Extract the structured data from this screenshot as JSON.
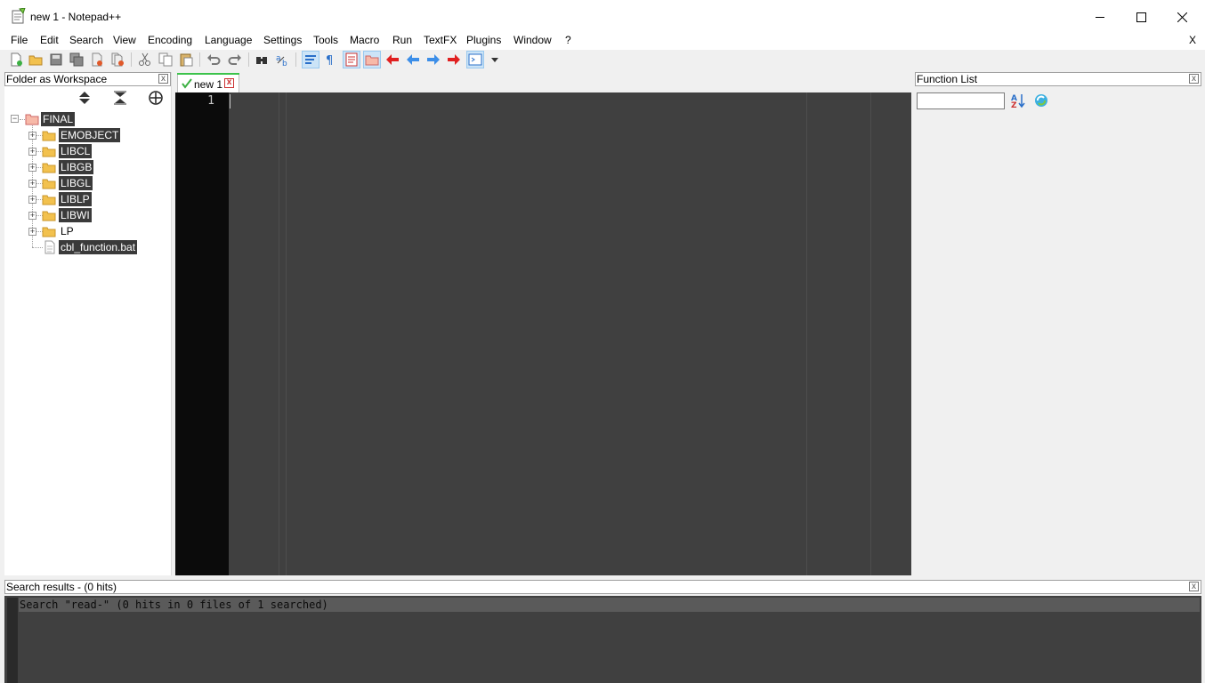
{
  "window": {
    "title": "new 1 - Notepad++",
    "app_icon": "notepad-icon",
    "controls": [
      "minimize-icon",
      "maximize-icon",
      "close-icon"
    ]
  },
  "menu": {
    "items": [
      "File",
      "Edit",
      "Search",
      "View",
      "Encoding",
      "Language",
      "Settings",
      "Tools",
      "Macro",
      "Run",
      "TextFX",
      "Plugins",
      "Window",
      "?"
    ],
    "close_x": "X"
  },
  "toolbar": {
    "icons": [
      "new-file-icon",
      "open-file-icon",
      "save-icon",
      "save-all-icon",
      "close-icon",
      "close-all-icon",
      "cut-icon",
      "copy-icon",
      "paste-icon",
      "undo-icon",
      "redo-icon",
      "find-icon",
      "replace-icon",
      "word-wrap-icon",
      "show-all-chars-icon",
      "doc-map-icon",
      "folder-workspace-icon",
      "jump-back-red-icon",
      "back-icon",
      "forward-icon",
      "jump-forward-red-icon",
      "function-list-icon",
      "dropdown-arrow-icon"
    ]
  },
  "left_panel": {
    "title": "Folder as Workspace",
    "close": "x",
    "controls": [
      "expand-all-icon",
      "collapse-all-icon",
      "locate-icon"
    ],
    "tree": {
      "root": "FINAL",
      "children": [
        {
          "label": "EMOBJECT",
          "type": "folder",
          "selected": true
        },
        {
          "label": "LIBCL",
          "type": "folder",
          "selected": true
        },
        {
          "label": "LIBGB",
          "type": "folder",
          "selected": true
        },
        {
          "label": "LIBGL",
          "type": "folder",
          "selected": true
        },
        {
          "label": "LIBLP",
          "type": "folder",
          "selected": true
        },
        {
          "label": "LIBWI",
          "type": "folder",
          "selected": true
        },
        {
          "label": "LP",
          "type": "folder",
          "selected": false
        },
        {
          "label": "cbl_function.bat",
          "type": "file",
          "selected": true
        }
      ]
    }
  },
  "editor": {
    "tab": {
      "label": "new 1",
      "status_icon": "saved-check-icon",
      "close": "x"
    },
    "line_numbers": [
      "1"
    ],
    "content": ""
  },
  "right_panel": {
    "title": "Function List",
    "close": "x",
    "search_value": "",
    "buttons": [
      "sort-az-icon",
      "reload-icon"
    ]
  },
  "bottom_panel": {
    "title": "Search results - (0 hits)",
    "close": "x",
    "result_line": "Search \"read-\" (0 hits in 0 files of 1 searched)"
  },
  "colors": {
    "editor_bg": "#404040",
    "gutter_bg": "#0b0b0b",
    "tab_accent": "#3cc34b",
    "selection_bg": "#3a3a3a"
  }
}
